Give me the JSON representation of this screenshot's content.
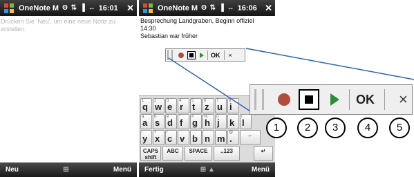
{
  "left_screen": {
    "app_title": "OneNote M",
    "status_icons": "෸ʘ ↕ ▐ ↔",
    "time": "16:01",
    "hint": "Drücken Sie 'Neu', um eine neue Notiz zu erstellen.",
    "softkeys": {
      "left": "Neu",
      "middle": "⊞",
      "right": "Menü"
    }
  },
  "right_screen": {
    "app_title": "OneNote M",
    "time": "16:06",
    "note_lines": [
      "Besprechung Landgraben, Beginn offiziel",
      "14:30",
      "Sebastian war früher"
    ],
    "mini_toolbar": {
      "ok": "OK",
      "close": "×"
    },
    "keyboard": {
      "row1": [
        [
          "1",
          "",
          "q"
        ],
        [
          "2",
          "",
          "w"
        ],
        [
          "3",
          "",
          "e"
        ],
        [
          "4",
          "",
          "r"
        ],
        [
          "5",
          "",
          "t"
        ],
        [
          "6",
          "",
          "z"
        ],
        [
          "7",
          "",
          "u"
        ],
        [
          "8",
          "",
          "i"
        ]
      ],
      "row2": [
        [
          "à",
          "",
          "a"
        ],
        [
          "ß",
          "",
          "s"
        ],
        [
          "è",
          "",
          "d"
        ],
        [
          "*",
          "",
          "f"
        ],
        [
          "#",
          "",
          "g"
        ],
        [
          "%",
          "",
          "h"
        ],
        [
          "ù",
          "",
          "j"
        ],
        [
          "",
          "",
          "k"
        ],
        [
          "ì",
          "",
          "l"
        ]
      ],
      "row3": [
        [
          "!",
          "",
          "y"
        ],
        [
          "?",
          "",
          "x"
        ],
        [
          "/",
          "",
          "c"
        ],
        [
          "",
          "",
          "v"
        ],
        [
          "",
          "",
          "b"
        ],
        [
          "",
          "",
          "n"
        ],
        [
          "",
          "",
          "m"
        ],
        [
          "@",
          "",
          "."
        ]
      ],
      "caps": "CAPS shift",
      "abc": "ABC",
      "space": "SPACE",
      "num": ".,123",
      "back": "←",
      "enter": "↵"
    },
    "softkeys": {
      "left": "Fertig",
      "middle": "⊞ ▲",
      "right": "Menü"
    }
  },
  "zoom_toolbar": {
    "ok": "OK",
    "close": "×"
  },
  "callouts": [
    "1",
    "2",
    "3",
    "4",
    "5"
  ],
  "colors": {
    "record": "#b34b3b",
    "play": "#2e8b36",
    "titlebar": "#2a2a2a",
    "callout_line": "#2d63b5"
  }
}
